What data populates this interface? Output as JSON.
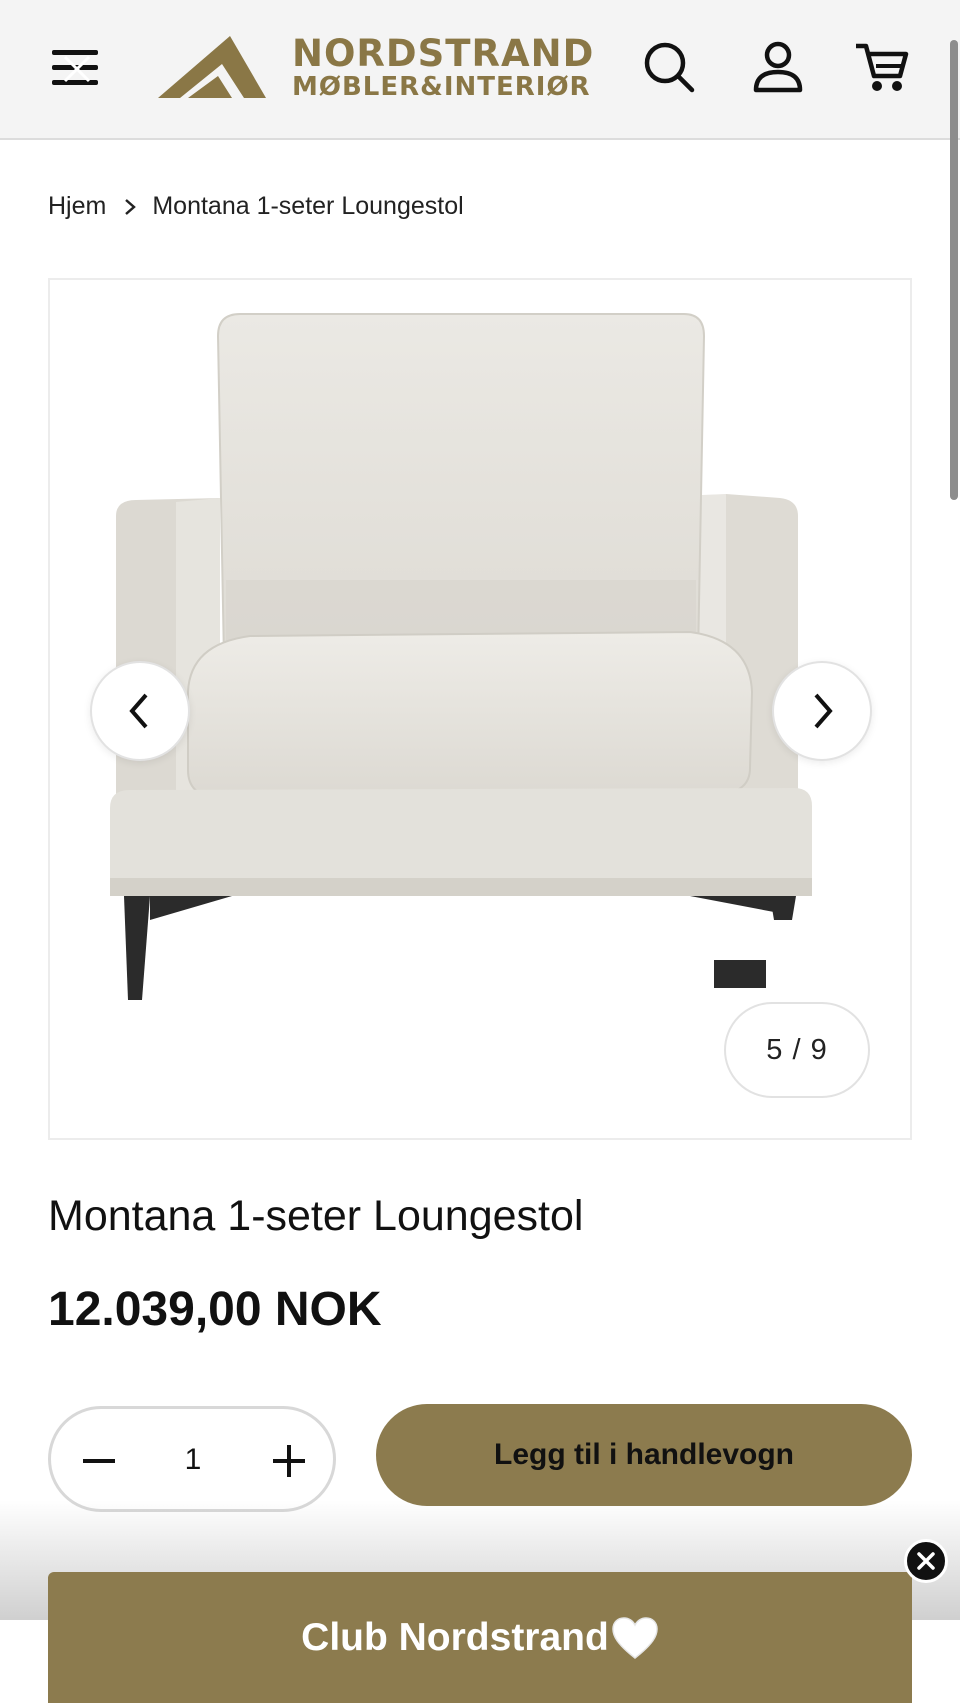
{
  "header": {
    "logo_name": "NORDSTRAND",
    "logo_subtitle": "MØBLER&INTERIØR",
    "icons": [
      "menu-icon",
      "search-icon",
      "account-icon",
      "cart-icon"
    ],
    "brand_color": "#8a7746"
  },
  "breadcrumb": {
    "home": "Hjem",
    "current": "Montana 1-seter Loungestol"
  },
  "gallery": {
    "counter": "5 / 9",
    "icons": [
      "chevron-left-icon",
      "chevron-right-icon"
    ]
  },
  "product": {
    "title": "Montana 1-seter Loungestol",
    "price": "12.039,00 NOK"
  },
  "quantity": {
    "value": "1"
  },
  "add_to_cart": {
    "label": "Legg til i handlevogn",
    "color": "#8c7b4e"
  },
  "banner": {
    "label": "Club Nordstrand",
    "icon": "white-heart-icon"
  }
}
